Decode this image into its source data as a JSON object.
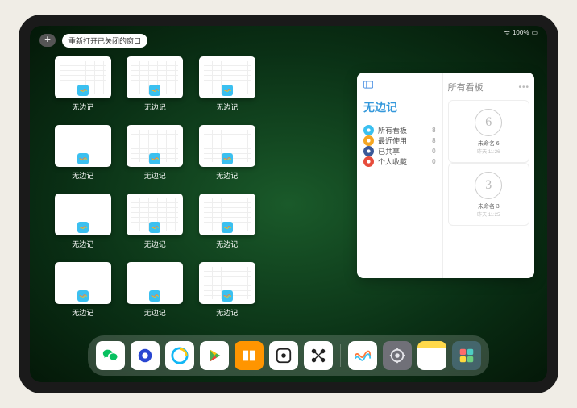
{
  "status": {
    "signal": "􀙇",
    "battery": "100%"
  },
  "topbar": {
    "plus": "+",
    "reopen": "重新打开已关闭的窗口"
  },
  "windows": [
    {
      "label": "无边记",
      "style": "content"
    },
    {
      "label": "无边记",
      "style": "content"
    },
    {
      "label": "无边记",
      "style": "content"
    },
    {
      "label": "",
      "style": "placeholder"
    },
    {
      "label": "无边记",
      "style": "blank"
    },
    {
      "label": "无边记",
      "style": "content"
    },
    {
      "label": "无边记",
      "style": "content"
    },
    {
      "label": "",
      "style": "placeholder"
    },
    {
      "label": "无边记",
      "style": "blank"
    },
    {
      "label": "无边记",
      "style": "content"
    },
    {
      "label": "无边记",
      "style": "content"
    },
    {
      "label": "",
      "style": "placeholder"
    },
    {
      "label": "无边记",
      "style": "blank"
    },
    {
      "label": "无边记",
      "style": "blank"
    },
    {
      "label": "无边记",
      "style": "content"
    }
  ],
  "detail": {
    "title": "无边记",
    "items": [
      {
        "label": "所有看板",
        "color": "#3bc0f0",
        "count": 8
      },
      {
        "label": "最近使用",
        "color": "#f5a623",
        "count": 8
      },
      {
        "label": "已共享",
        "color": "#3b5998",
        "count": 0
      },
      {
        "label": "个人收藏",
        "color": "#e74c3c",
        "count": 0
      }
    ],
    "right_title": "所有看板",
    "boards": [
      {
        "num": "6",
        "name": "未命名 6",
        "sub": "昨天 11:26"
      },
      {
        "num": "3",
        "name": "未命名 3",
        "sub": "昨天 11:25"
      }
    ]
  },
  "dock": [
    {
      "name": "wechat",
      "cls": "di-wechat"
    },
    {
      "name": "netease",
      "cls": "di-netease"
    },
    {
      "name": "qq",
      "cls": "di-qq"
    },
    {
      "name": "play",
      "cls": "di-play"
    },
    {
      "name": "books",
      "cls": "di-books"
    },
    {
      "name": "alt",
      "cls": "di-alt"
    },
    {
      "name": "connect",
      "cls": "di-connect"
    },
    {
      "name": "freeform",
      "cls": "di-freeform"
    },
    {
      "name": "settings",
      "cls": "di-settings"
    },
    {
      "name": "notes",
      "cls": "di-notes"
    },
    {
      "name": "apps",
      "cls": "di-apps"
    }
  ]
}
